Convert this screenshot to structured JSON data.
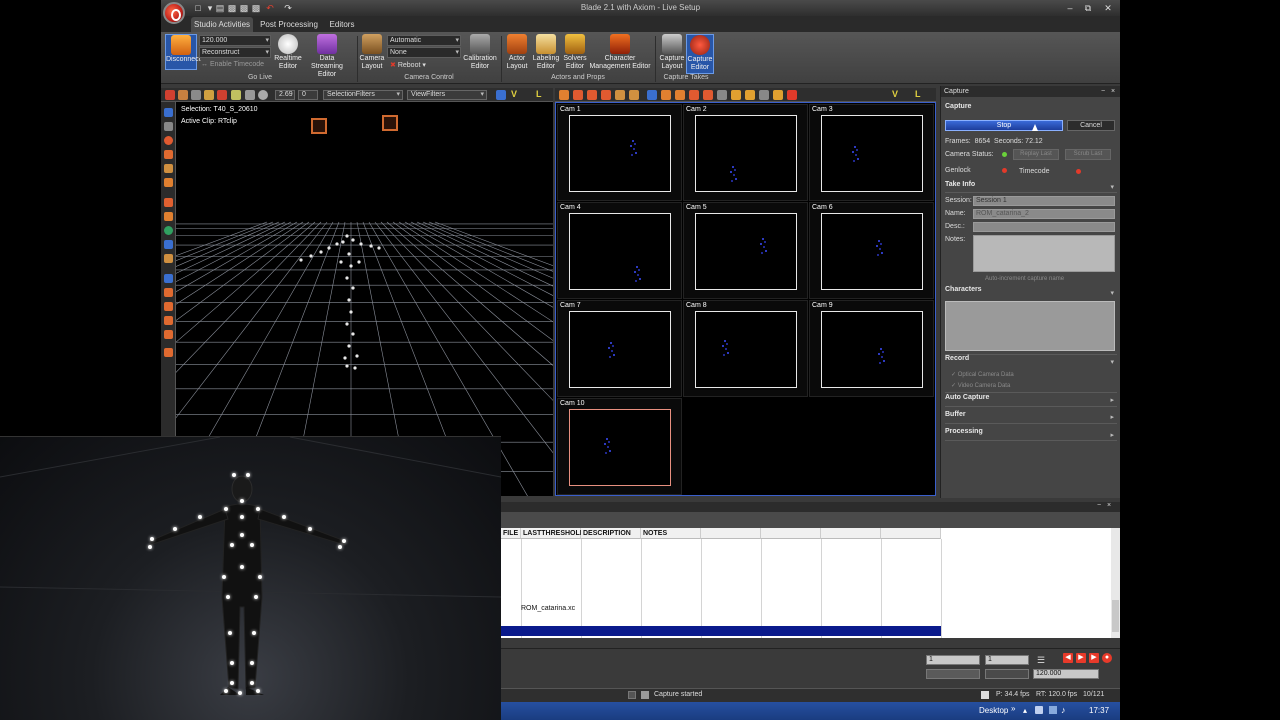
{
  "window": {
    "title": "Blade 2.1 with Axiom - Live Setup"
  },
  "tabs": [
    "Studio Activities",
    "Post Processing",
    "Editors"
  ],
  "ribbon": {
    "disconnect_label": "Disconnect",
    "rate_value": "120.000",
    "reconstruct_value": "Reconstruct",
    "enable_timecode_label": "Enable Timecode",
    "realtime_editor": "Realtime Editor",
    "data_streaming_editor": "Data Streaming Editor",
    "camera_layout": "Camera Layout",
    "automatic_value": "Automatic",
    "none_value": "None",
    "reboot_label": "Reboot",
    "calibration_editor": "Calibration Editor",
    "actor_layout": "Actor Layout",
    "labeling_editor": "Labeling Editor",
    "solvers_editor": "Solvers Editor",
    "character_management_editor": "Character Management Editor",
    "capture_layout": "Capture Layout",
    "capture_editor": "Capture Editor",
    "group_go_live": "Go Live",
    "group_camera_control": "Camera Control",
    "group_actors_props": "Actors and Props",
    "group_capture_takes": "Capture Takes"
  },
  "viewport": {
    "frame_field": "2.69",
    "zero_field": "0",
    "selection_filters": "SelectionFilters",
    "view_filters": "ViewFilters",
    "v_label": "V",
    "l_label": "L",
    "selection_text": "Selection: T40_S_20610",
    "active_clip_text": "Active Clip: RTclip"
  },
  "cameras": [
    "Cam 1",
    "Cam 2",
    "Cam 3",
    "Cam 4",
    "Cam 5",
    "Cam 6",
    "Cam 7",
    "Cam 8",
    "Cam 9",
    "Cam 10"
  ],
  "capture": {
    "panel_title": "Capture",
    "section_title": "Capture",
    "stop_label": "Stop",
    "cancel_label": "Cancel",
    "frames_label": "Frames:",
    "frames_value": "8654",
    "seconds_label": "Seconds:",
    "seconds_value": "72.12",
    "camera_status_label": "Camera Status:",
    "replay_last": "Replay Last",
    "scrub_last": "Scrub Last",
    "genlock_label": "Genlock",
    "timecode_label": "Timecode",
    "take_info_title": "Take Info",
    "session_label": "Session:",
    "session_value": "Session 1",
    "name_label": "Name:",
    "name_value": "ROM_catarina_2",
    "desc_label": "Desc.:",
    "notes_label": "Notes:",
    "auto_increment": "Auto-increment capture name",
    "characters_title": "Characters",
    "record_title": "Record",
    "optical_camera_data": "Optical Camera Data",
    "video_camera_data": "Video Camera Data",
    "auto_capture_title": "Auto Capture",
    "buffer_title": "Buffer",
    "processing_title": "Processing",
    "led_green": "#6ad13a",
    "led_red": "#e33a2a"
  },
  "table": {
    "headers": [
      "FILE",
      "LASTTHRESHOLD",
      "DESCRIPTION",
      "NOTES"
    ],
    "row_value": "ROM_catarina.xc"
  },
  "timeline": {
    "start_field": "1",
    "end_field": "1",
    "rate_field": "120.000"
  },
  "status": {
    "message": "Capture started",
    "fps_p": "P: 34.4 fps",
    "fps_rt": "RT: 120.0 fps",
    "frame_counter": "10/121"
  },
  "taskbar": {
    "desktop_label": "Desktop",
    "clock": "17:37"
  }
}
